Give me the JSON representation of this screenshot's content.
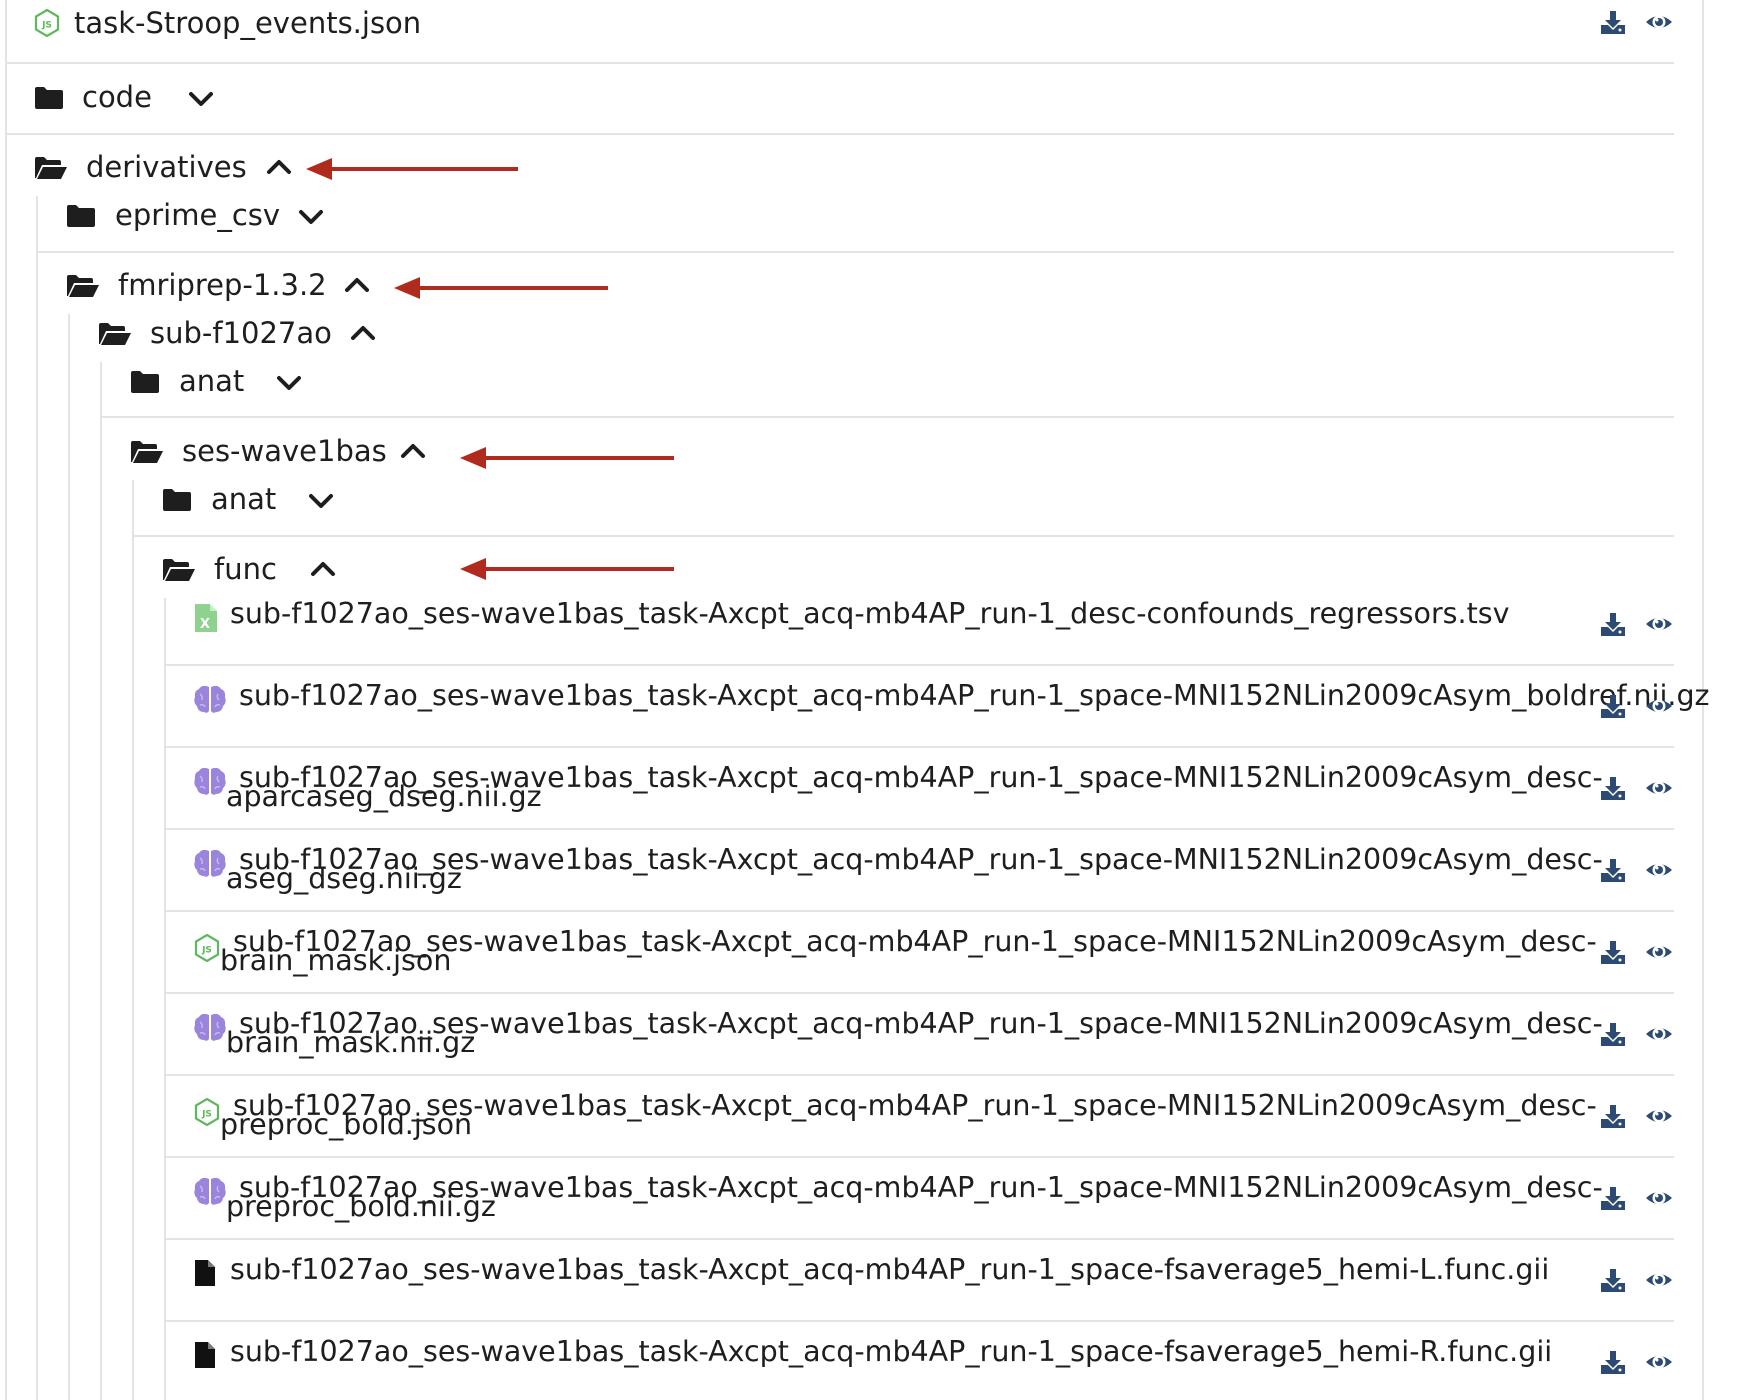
{
  "top_file": {
    "name": "task-Stroop_events.json",
    "icon": "json-icon"
  },
  "folders": {
    "code": "code",
    "derivatives": "derivatives",
    "eprime_csv": "eprime_csv",
    "fmriprep": "fmriprep-1.3.2",
    "sub": "sub-f1027ao",
    "anat1": "anat",
    "ses": "ses-wave1bas",
    "anat2": "anat",
    "func": "func"
  },
  "files": [
    {
      "icon": "spreadsheet-icon",
      "line1": "sub-f1027ao_ses-wave1bas_task-Axcpt_acq-mb4AP_run-1_desc-confounds_regressors.tsv",
      "line2": ""
    },
    {
      "icon": "brain-icon",
      "line1": "sub-f1027ao_ses-wave1bas_task-Axcpt_acq-mb4AP_run-1_space-MNI152NLin2009cAsym_boldref.nii.gz",
      "line2": ""
    },
    {
      "icon": "brain-icon",
      "line1": "sub-f1027ao_ses-wave1bas_task-Axcpt_acq-mb4AP_run-1_space-MNI152NLin2009cAsym_desc-",
      "line2": "aparcaseg_dseg.nii.gz"
    },
    {
      "icon": "brain-icon",
      "line1": "sub-f1027ao_ses-wave1bas_task-Axcpt_acq-mb4AP_run-1_space-MNI152NLin2009cAsym_desc-",
      "line2": "aseg_dseg.nii.gz"
    },
    {
      "icon": "json-icon",
      "line1": "sub-f1027ao_ses-wave1bas_task-Axcpt_acq-mb4AP_run-1_space-MNI152NLin2009cAsym_desc-",
      "line2": "brain_mask.json"
    },
    {
      "icon": "brain-icon",
      "line1": "sub-f1027ao_ses-wave1bas_task-Axcpt_acq-mb4AP_run-1_space-MNI152NLin2009cAsym_desc-",
      "line2": "brain_mask.nii.gz"
    },
    {
      "icon": "json-icon",
      "line1": "sub-f1027ao_ses-wave1bas_task-Axcpt_acq-mb4AP_run-1_space-MNI152NLin2009cAsym_desc-",
      "line2": "preproc_bold.json"
    },
    {
      "icon": "brain-icon",
      "line1": "sub-f1027ao_ses-wave1bas_task-Axcpt_acq-mb4AP_run-1_space-MNI152NLin2009cAsym_desc-",
      "line2": "preproc_bold.nii.gz"
    },
    {
      "icon": "file-icon",
      "line1": "sub-f1027ao_ses-wave1bas_task-Axcpt_acq-mb4AP_run-1_space-fsaverage5_hemi-L.func.gii",
      "line2": ""
    },
    {
      "icon": "file-icon",
      "line1": "sub-f1027ao_ses-wave1bas_task-Axcpt_acq-mb4AP_run-1_space-fsaverage5_hemi-R.func.gii",
      "line2": ""
    }
  ],
  "colors": {
    "json_icon": "#5cb85c",
    "tsv_icon": "#8fd18f",
    "brain_icon": "#9a84dc",
    "action_icon": "#2c4a73",
    "annotation_arrow": "#b02a1e",
    "divider": "#e4e4e4"
  }
}
